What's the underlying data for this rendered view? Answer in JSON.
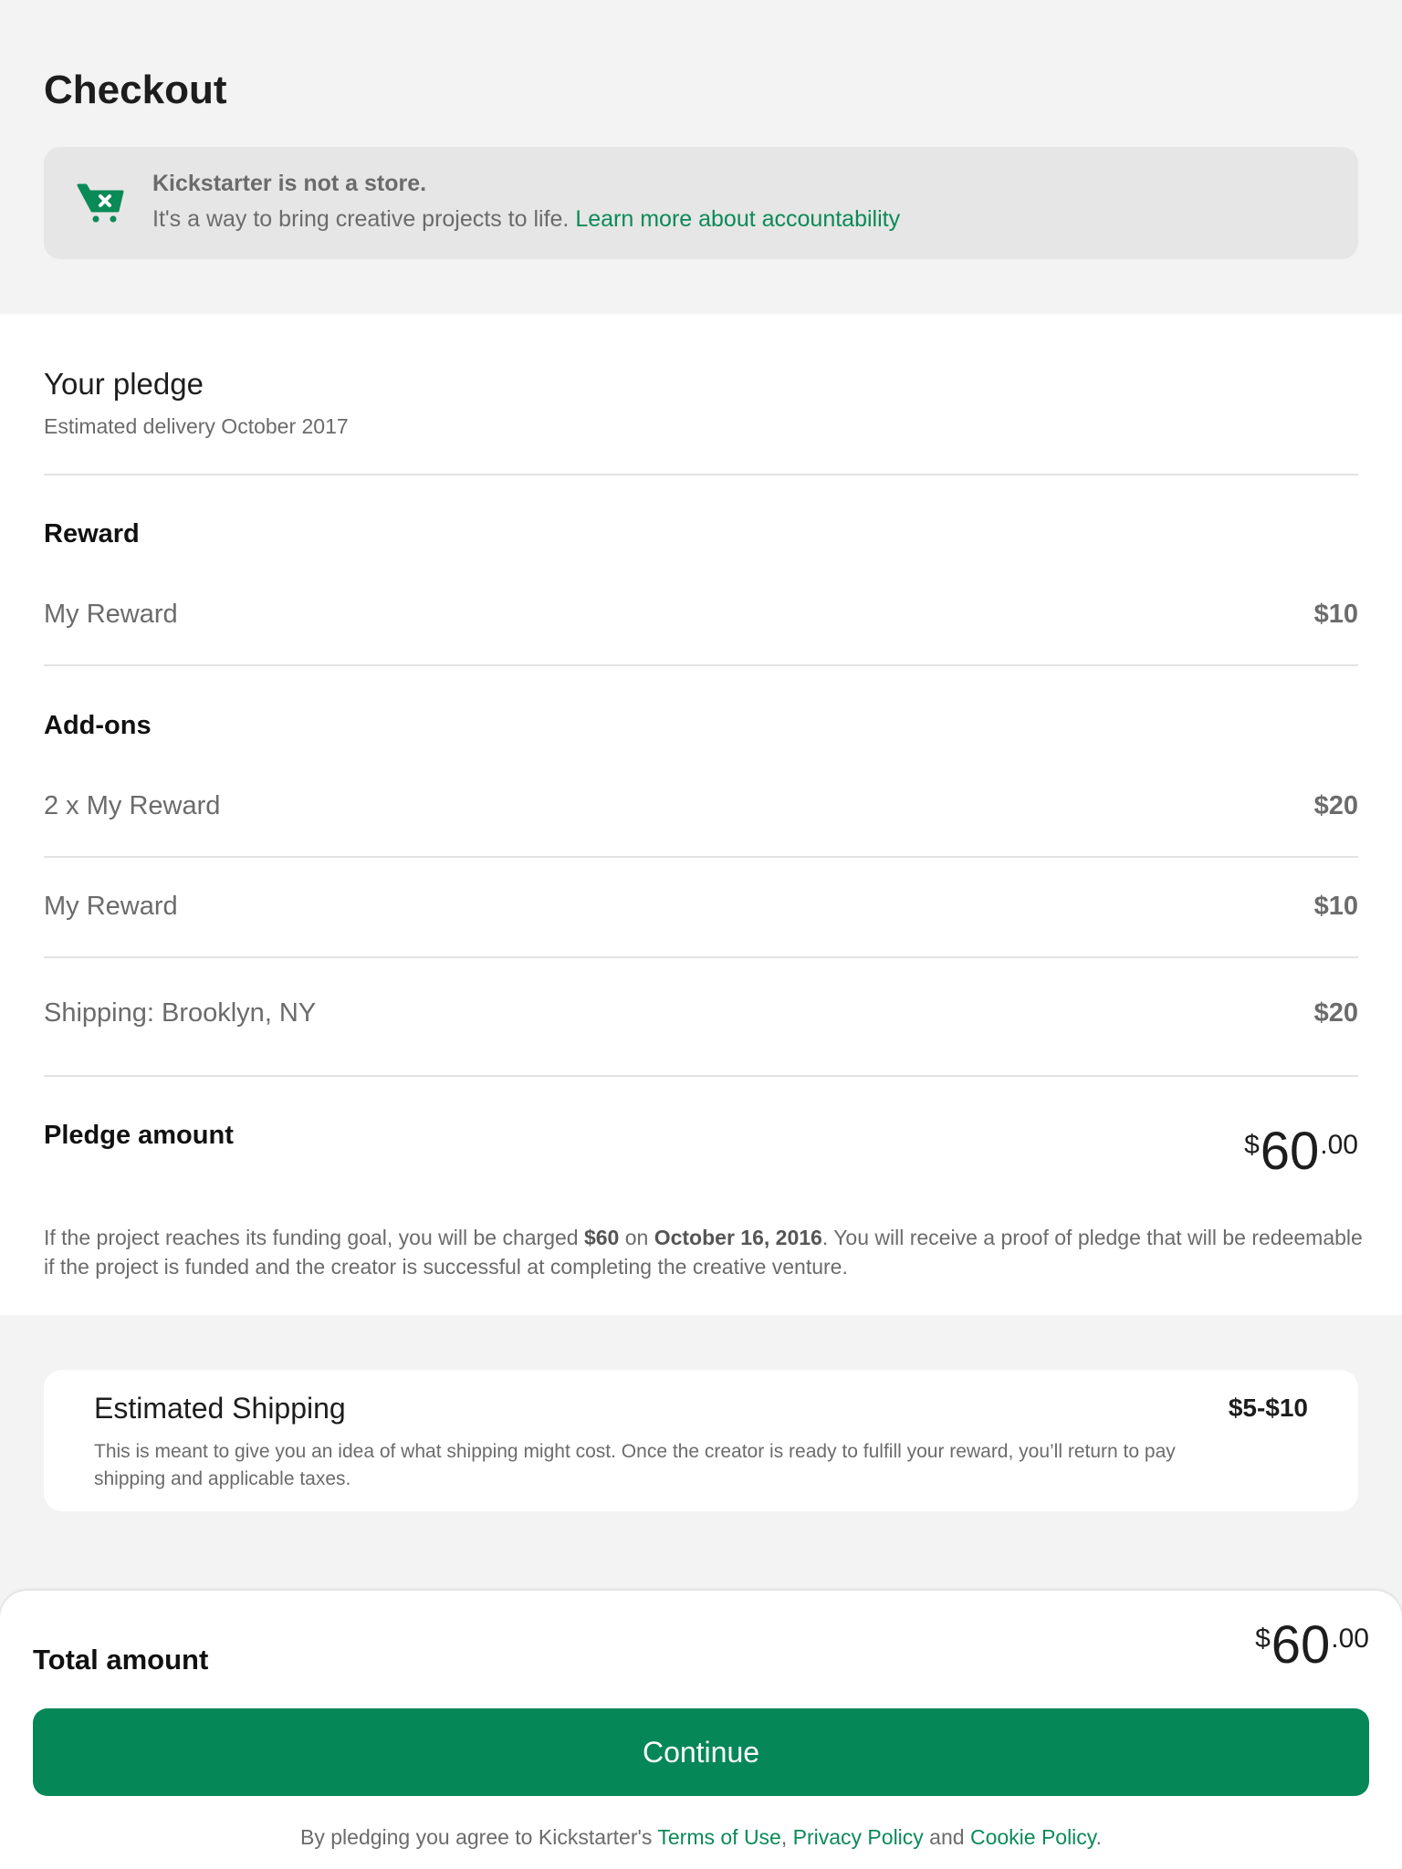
{
  "header": {
    "title": "Checkout",
    "notice": {
      "icon": "cart-x-icon",
      "title": "Kickstarter is not a store.",
      "text": "It's a way to bring creative projects to life.",
      "link": "Learn more about accountability"
    }
  },
  "pledge": {
    "title": "Your pledge",
    "delivery": "Estimated delivery October 2017",
    "reward_label": "Reward",
    "reward": {
      "name": "My Reward",
      "price": "$10"
    },
    "addons_label": "Add-ons",
    "addons": [
      {
        "name": "2 x My Reward",
        "price": "$20"
      },
      {
        "name": "My Reward",
        "price": "$10"
      }
    ],
    "shipping": {
      "name": "Shipping: Brooklyn, NY",
      "price": "$20"
    },
    "amount_label": "Pledge amount",
    "amount": {
      "currency": "$",
      "integer": "60",
      "decimal": ".00"
    },
    "charge_note": {
      "part1": "If the project reaches its funding goal, you will be charged ",
      "amount": "$60",
      "part2": " on ",
      "date": "October 16, 2016",
      "part3": ". You will receive a proof of pledge that will be redeemable if the project is funded and the creator is successful at completing the creative venture."
    }
  },
  "estimated_shipping": {
    "title": "Estimated Shipping",
    "range": "$5-$10",
    "description": "This is meant to give you an idea of what shipping might cost. Once the creator is ready to fulfill your reward, you’ll return to pay shipping and applicable taxes."
  },
  "footer": {
    "total_label": "Total amount",
    "total": {
      "currency": "$",
      "integer": "60",
      "decimal": ".00"
    },
    "continue_label": "Continue",
    "legal": {
      "prefix": "By pledging you agree to Kickstarter's ",
      "terms": "Terms of Use",
      "sep1": ", ",
      "privacy": "Privacy Policy",
      "sep2": " and ",
      "cookie": "Cookie Policy",
      "suffix": "."
    }
  },
  "colors": {
    "accent": "#058757",
    "link": "#0a8a57",
    "background": "#f3f3f3",
    "notice_bg": "#e6e6e6"
  }
}
